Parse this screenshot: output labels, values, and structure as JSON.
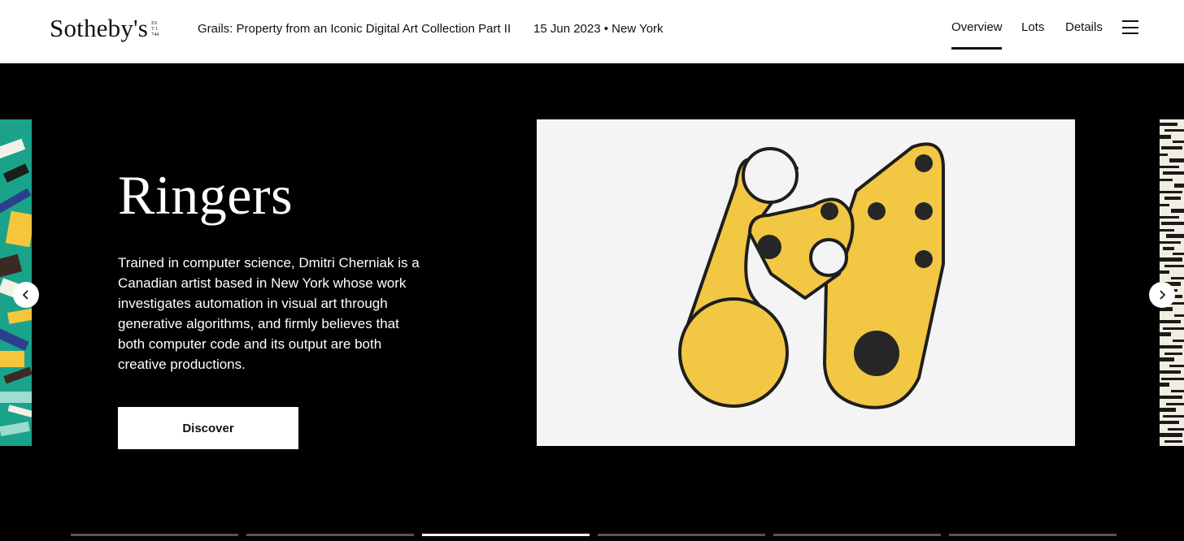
{
  "header": {
    "logo": "Sotheby's",
    "logo_est": "EST 1744",
    "sale_title": "Grails: Property from an Iconic Digital Art Collection Part II",
    "sale_date": "15 Jun 2023 • New York",
    "nav": {
      "overview": "Overview",
      "lots": "Lots",
      "details": "Details"
    },
    "active_nav": "Overview",
    "menu_icon": "hamburger-menu-icon"
  },
  "hero": {
    "heading": "Ringers",
    "description": "Trained in computer science, Dmitri Cherniak is a Canadian artist based in New York whose work investigates automation in visual art through generative algorithms, and firmly believes that both computer code and its output are both creative productions.",
    "button_label": "Discover",
    "prev_icon": "chevron-left-icon",
    "next_icon": "chevron-right-icon",
    "slide_count": 6,
    "active_slide": 3
  },
  "colors": {
    "header_bg": "#ffffff",
    "hero_bg": "#000000",
    "artwork_yellow": "#f2c744",
    "artwork_bg": "#f4f4f4",
    "peek_green": "#1aa38a"
  }
}
